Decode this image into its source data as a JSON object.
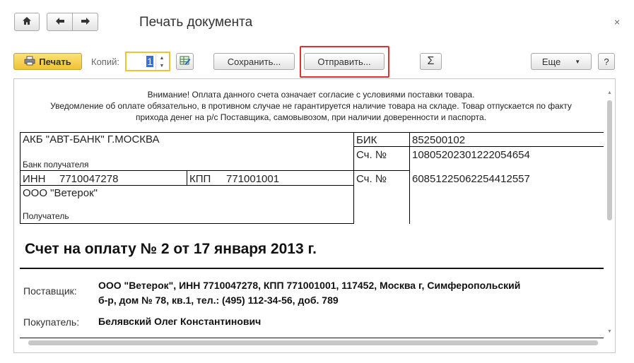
{
  "window": {
    "title": "Печать документа",
    "close_label": "×"
  },
  "toolbar": {
    "home_icon": "home-icon",
    "print_label": "Печать",
    "copies_label": "Копий:",
    "copies_value": "1",
    "save_label": "Сохранить...",
    "send_label": "Отправить...",
    "sum_label": "Σ",
    "more_label": "Еще",
    "help_label": "?"
  },
  "document": {
    "notice_lines": [
      "Внимание! Оплата данного счета означает согласие с условиями поставки товара.",
      "Уведомление об оплате обязательно, в противном случае не гарантируется наличие товара на складе. Товар отпускается по факту",
      "прихода денег на р/с Поставщика, самовывозом, при наличии доверенности и паспорта."
    ],
    "bank": {
      "bank_name": "АКБ \"АВТ-БАНК\" Г.МОСКВА",
      "bank_caption": "Банк получателя",
      "bik_label": "БИК",
      "bik_value": "852500102",
      "acc1_label": "Сч. №",
      "acc1_value": "10805202301222054654",
      "inn_label": "ИНН",
      "inn_value": "7710047278",
      "kpp_label": "КПП",
      "kpp_value": "771001001",
      "acc2_label": "Сч. №",
      "acc2_value": "60851225062254412557",
      "recipient_name": "ООО \"Ветерок\"",
      "recipient_caption": "Получатель"
    },
    "invoice_title": "Счет на оплату № 2 от 17 января 2013 г.",
    "supplier_label": "Поставщик:",
    "supplier_line1": "ООО \"Ветерок\",  ИНН 7710047278,  КПП 771001001,  117452, Москва г, Симферопольский",
    "supplier_line2": "б-р, дом № 78, кв.1,  тел.: (495) 112-34-56, доб. 789",
    "buyer_label": "Покупатель:",
    "buyer_value": "Белявский Олег Константинович"
  },
  "colors": {
    "print_button": "#f2c233",
    "send_highlight": "#e03030"
  }
}
